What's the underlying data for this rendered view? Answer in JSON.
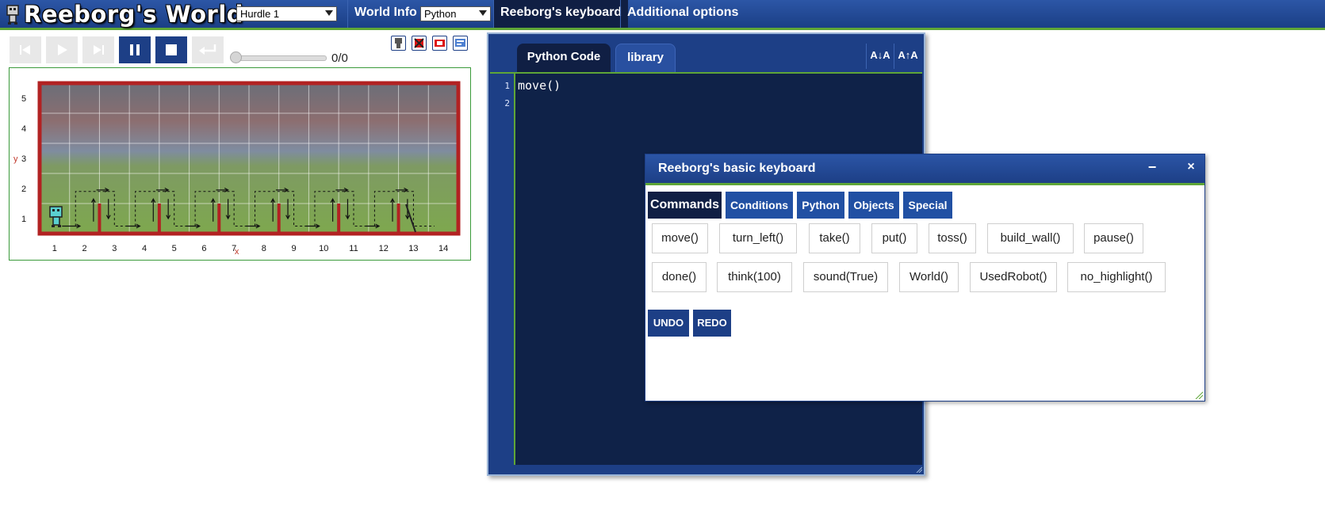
{
  "header": {
    "app_title": "Reeborg's World",
    "world_select": "Hurdle 1",
    "world_info": "World Info",
    "language_select": "Python",
    "keyboard": "Reeborg's keyboard",
    "additional_options": "Additional options"
  },
  "controls": {
    "step_counter": "0/0"
  },
  "world": {
    "rows": 5,
    "cols": 14,
    "x_labels": [
      "1",
      "2",
      "3",
      "4",
      "5",
      "6",
      "7",
      "8",
      "9",
      "10",
      "11",
      "12",
      "13",
      "14"
    ],
    "y_labels": [
      "1",
      "2",
      "3",
      "4",
      "5"
    ],
    "x_axis_marker": "x",
    "y_axis_marker": "y",
    "wall_color": "#b22222",
    "robot": {
      "x": 1,
      "y": 1
    },
    "goal": {
      "x": 13,
      "y": 1
    },
    "walls_east_of": [
      2,
      4,
      6,
      8,
      10,
      12
    ],
    "hurdle_path": [
      2,
      4,
      6,
      8,
      10,
      12
    ]
  },
  "editor": {
    "tab_python": "Python Code",
    "tab_library": "library",
    "font_decrease": "A↓A",
    "font_increase": "A↑A",
    "line_numbers": [
      "1",
      "2"
    ],
    "code_lines": [
      "move()",
      ""
    ]
  },
  "keyboard": {
    "title": "Reeborg's basic keyboard",
    "minimize": "−",
    "close": "×",
    "tabs": [
      "Commands",
      "Conditions",
      "Python",
      "Objects",
      "Special"
    ],
    "row1": [
      "move()",
      "turn_left()",
      "take()",
      "put()",
      "toss()",
      "build_wall()",
      "pause()"
    ],
    "row2": [
      "done()",
      "think(100)",
      "sound(True)",
      "World()",
      "UsedRobot()",
      "no_highlight()"
    ],
    "undo": "UNDO",
    "redo": "REDO"
  },
  "colors": {
    "header_blue": "#1d3f86",
    "accent_green": "#5fa637",
    "editor_bg": "#0f2248"
  }
}
